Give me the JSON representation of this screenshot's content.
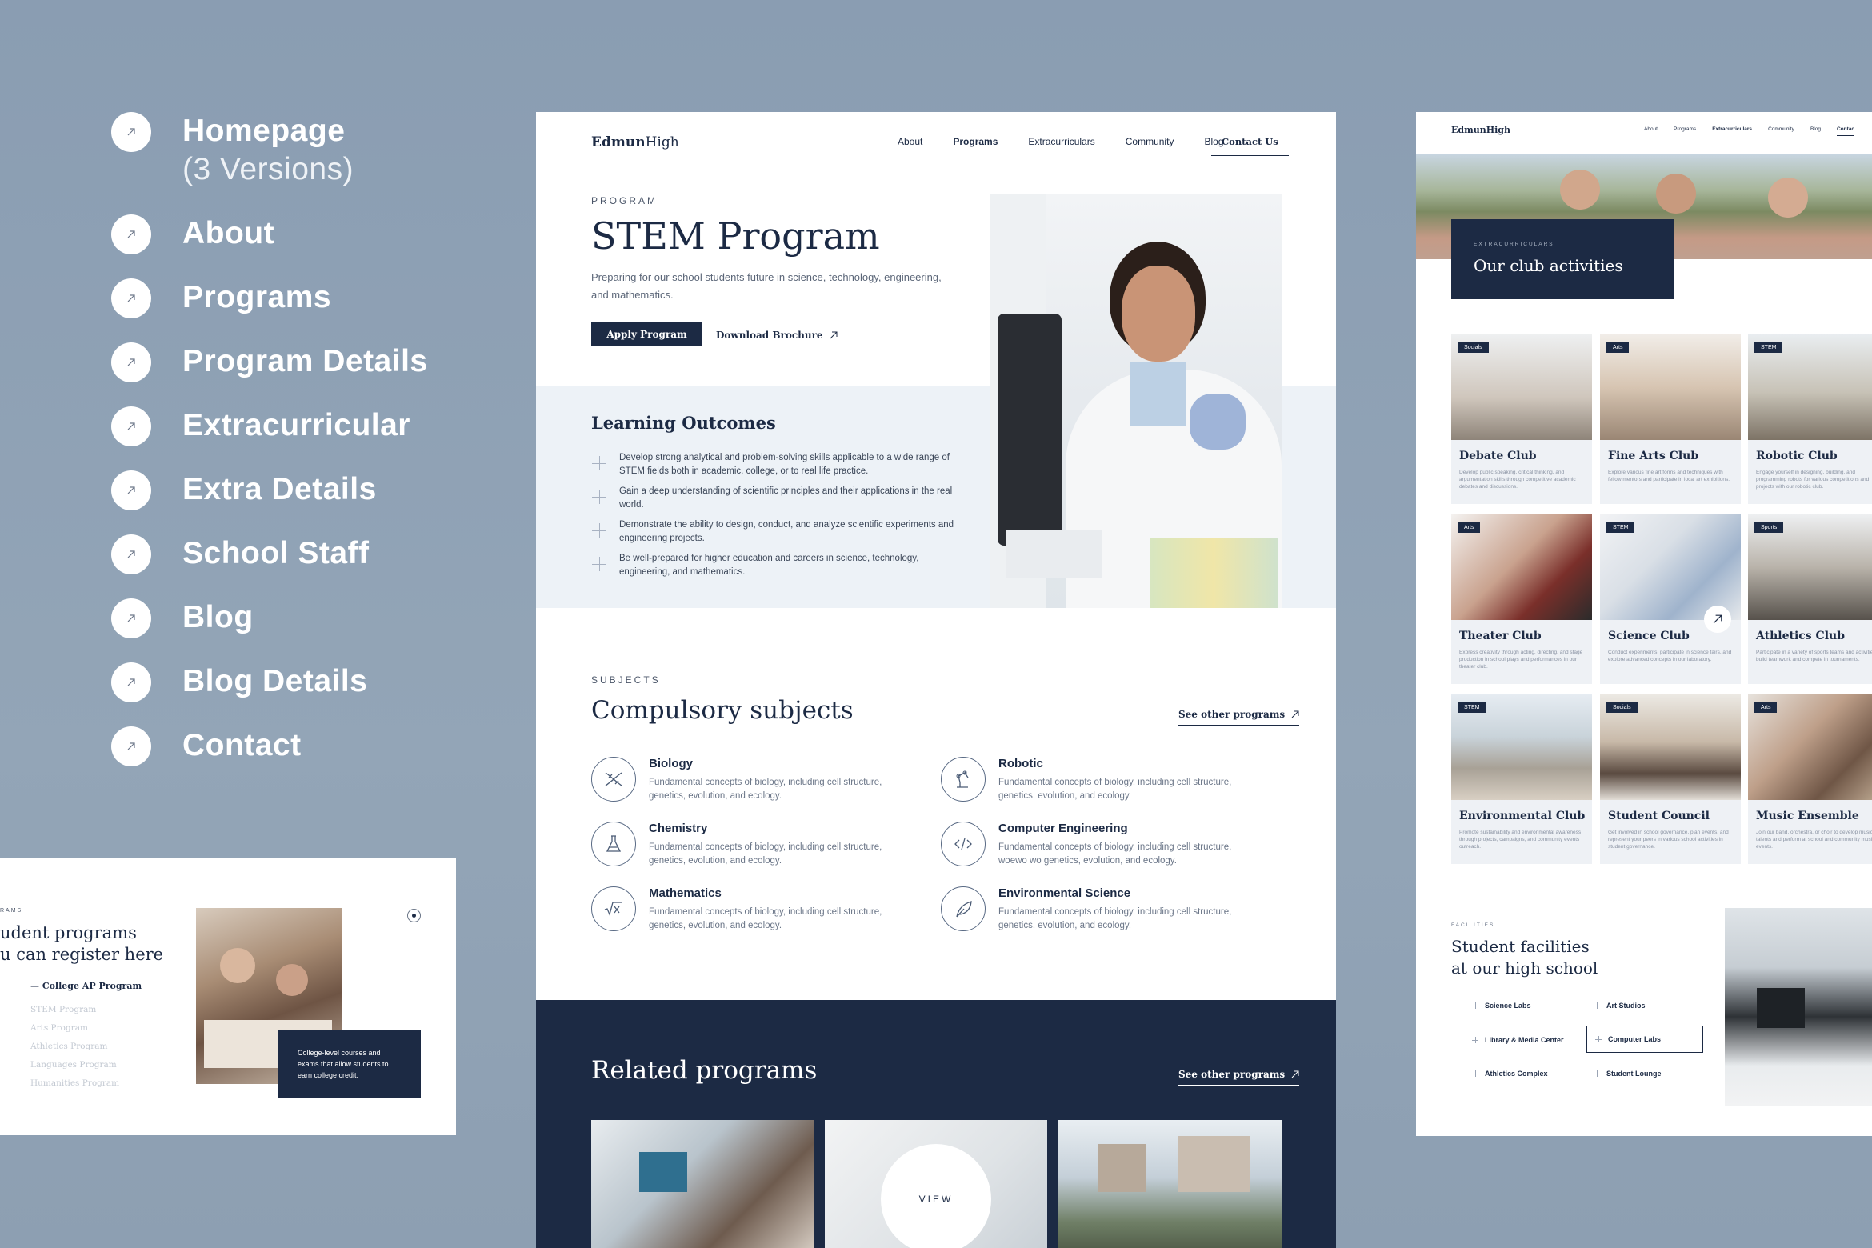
{
  "nav": [
    {
      "label": "Homepage",
      "sub": "(3 Versions)"
    },
    {
      "label": "About"
    },
    {
      "label": "Programs"
    },
    {
      "label": "Program Details"
    },
    {
      "label": "Extracurricular"
    },
    {
      "label": "Extra Details"
    },
    {
      "label": "School Staff"
    },
    {
      "label": "Blog"
    },
    {
      "label": "Blog Details"
    },
    {
      "label": "Contact"
    }
  ],
  "main": {
    "logo_a": "Edmun",
    "logo_b": "High",
    "menu": [
      "About",
      "Programs",
      "Extracurriculars",
      "Community",
      "Blog"
    ],
    "contact": "Contact Us",
    "eyebrow": "PROGRAM",
    "title": "STEM Program",
    "desc": "Preparing for our school students future in science, technology, engineering, and mathematics.",
    "apply": "Apply Program",
    "brochure": "Download Brochure",
    "outcomes_title": "Learning Outcomes",
    "outcomes": [
      "Develop strong analytical and problem-solving skills applicable to a wide range of STEM fields both in academic, college, or to real life practice.",
      "Gain a deep understanding of scientific principles and their applications in the real world.",
      "Demonstrate the ability to design, conduct, and analyze scientific experiments and engineering projects.",
      "Be well-prepared for higher education and careers in science, technology, engineering, and mathematics."
    ],
    "subjects_eyebrow": "SUBJECTS",
    "subjects_title": "Compulsory subjects",
    "see_other": "See other programs",
    "subjects": [
      {
        "name": "Biology",
        "desc": "Fundamental concepts of biology, including cell structure, genetics, evolution, and ecology."
      },
      {
        "name": "Robotic",
        "desc": "Fundamental concepts of biology, including cell structure, genetics, evolution, and ecology."
      },
      {
        "name": "Chemistry",
        "desc": "Fundamental concepts of biology, including cell structure, genetics, evolution, and ecology."
      },
      {
        "name": "Computer Engineering",
        "desc": "Fundamental concepts of biology, including cell structure, woewo wo genetics, evolution, and ecology."
      },
      {
        "name": "Mathematics",
        "desc": "Fundamental concepts of biology, including cell structure, genetics, evolution, and ecology."
      },
      {
        "name": "Environmental Science",
        "desc": "Fundamental concepts of biology, including cell structure, genetics, evolution, and ecology."
      }
    ],
    "related_title": "Related programs",
    "related_see": "See other programs",
    "view": "VIEW"
  },
  "right": {
    "logo": "EdmunHigh",
    "menu": [
      "About",
      "Programs",
      "Extracurriculars",
      "Community",
      "Blog",
      "Contac"
    ],
    "hero_eyebrow": "EXTRACURRICULARS",
    "hero_title": "Our club activities",
    "clubs": [
      {
        "tag": "Socials",
        "name": "Debate Club",
        "desc": "Develop public speaking, critical thinking, and argumentation skills through competitive academic debates and discussions."
      },
      {
        "tag": "Arts",
        "name": "Fine Arts Club",
        "desc": "Explore various fine art forms and techniques with fellow mentors and participate in local art exhibitions."
      },
      {
        "tag": "STEM",
        "name": "Robotic Club",
        "desc": "Engage yourself in designing, building, and programming robots for various competitions and projects with our robotic club."
      },
      {
        "tag": "Arts",
        "name": "Theater Club",
        "desc": "Express creativity through acting, directing, and stage production in school plays and performances in our theater club."
      },
      {
        "tag": "STEM",
        "name": "Science Club",
        "desc": "Conduct experiments, participate in science fairs, and explore advanced concepts in our laboratory."
      },
      {
        "tag": "Sports",
        "name": "Athletics Club",
        "desc": "Participate in a variety of sports teams and activities, build teamwork and compete in tournaments."
      },
      {
        "tag": "STEM",
        "name": "Environmental Club",
        "desc": "Promote sustainability and environmental awareness through projects, campaigns, and community events outreach."
      },
      {
        "tag": "Socials",
        "name": "Student Council",
        "desc": "Get involved in school governance, plan events, and represent your peers in various school activities in student governance."
      },
      {
        "tag": "Arts",
        "name": "Music Ensemble",
        "desc": "Join our band, orchestra, or choir to develop musical talents and perform at school and community music events."
      }
    ],
    "fac_eyebrow": "FACILITIES",
    "fac_title_1": "Student facilities",
    "fac_title_2": "at our high school",
    "facilities": [
      "Science Labs",
      "Art Studios",
      "Library & Media Center",
      "Computer Labs",
      "Athletics Complex",
      "Student Lounge"
    ]
  },
  "left_card": {
    "eyebrow": "RAMS",
    "title_1": "udent programs",
    "title_2": "u can register here",
    "active": "College AP Program",
    "items": [
      "STEM Program",
      "Arts Program",
      "Athletics Program",
      "Languages Program",
      "Humanities Program"
    ],
    "caption": "College-level courses and exams that allow students to earn college credit."
  }
}
